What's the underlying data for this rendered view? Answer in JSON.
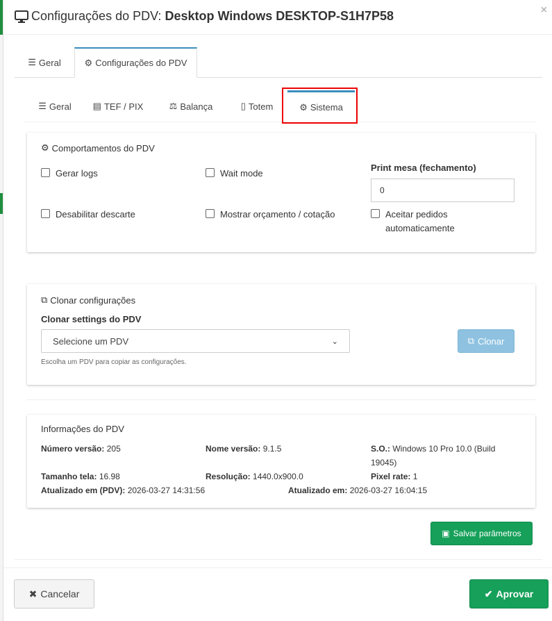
{
  "modal": {
    "title_prefix": "Configurações do PDV:",
    "title_device": "Desktop Windows DESKTOP-S1H7P58",
    "close_label": "×"
  },
  "tabs_main": [
    {
      "label": "Geral",
      "icon": "sliders-icon"
    },
    {
      "label": "Configurações do PDV",
      "icon": "cogs-icon",
      "active": true
    }
  ],
  "tabs_sub": [
    {
      "label": "Geral",
      "icon": "sliders-icon"
    },
    {
      "label": "TEF / PIX",
      "icon": "credit-card-icon"
    },
    {
      "label": "Balança",
      "icon": "balance-scale-icon"
    },
    {
      "label": "Totem",
      "icon": "tablet-icon"
    },
    {
      "label": "Sistema",
      "icon": "gear-icon",
      "active": true
    }
  ],
  "comportamentos": {
    "title": "Comportamentos do PDV",
    "gerar_logs": "Gerar logs",
    "wait_mode": "Wait mode",
    "print_mesa_label": "Print mesa (fechamento)",
    "print_mesa_value": "0",
    "desabilitar_descarte": "Desabilitar descarte",
    "mostrar_orcamento": "Mostrar orçamento / cotação",
    "aceitar_pedidos": "Aceitar pedidos automaticamente"
  },
  "clonar": {
    "title": "Clonar configurações",
    "label": "Clonar settings do PDV",
    "select_value": "Selecione um PDV",
    "help": "Escolha um PDV para copiar as configurações.",
    "button": "Clonar"
  },
  "info": {
    "title": "Informações do PDV",
    "numero_versao_label": "Número versão:",
    "numero_versao": "205",
    "nome_versao_label": "Nome versão:",
    "nome_versao": "9.1.5",
    "so_label": "S.O.:",
    "so_line1": "Windows 10 Pro 10.0 (Build",
    "so_line2": "19045)",
    "tamanho_tela_label": "Tamanho tela:",
    "tamanho_tela": "16.98",
    "resolucao_label": "Resolução:",
    "resolucao": "1440.0x900.0",
    "pixel_rate_label": "Pixel rate:",
    "pixel_rate": "1",
    "atualizado_pdv_label": "Atualizado em (PDV):",
    "atualizado_pdv": "2026-03-27 14:31:56",
    "atualizado_label": "Atualizado em:",
    "atualizado": "2026-03-27 16:04:15"
  },
  "buttons": {
    "salvar": "Salvar parâmetros",
    "cancelar": "Cancelar",
    "aprovar": "Aprovar"
  },
  "colors": {
    "primary": "#3c8dbc",
    "success": "#16a05a",
    "highlight": "#e00000"
  }
}
